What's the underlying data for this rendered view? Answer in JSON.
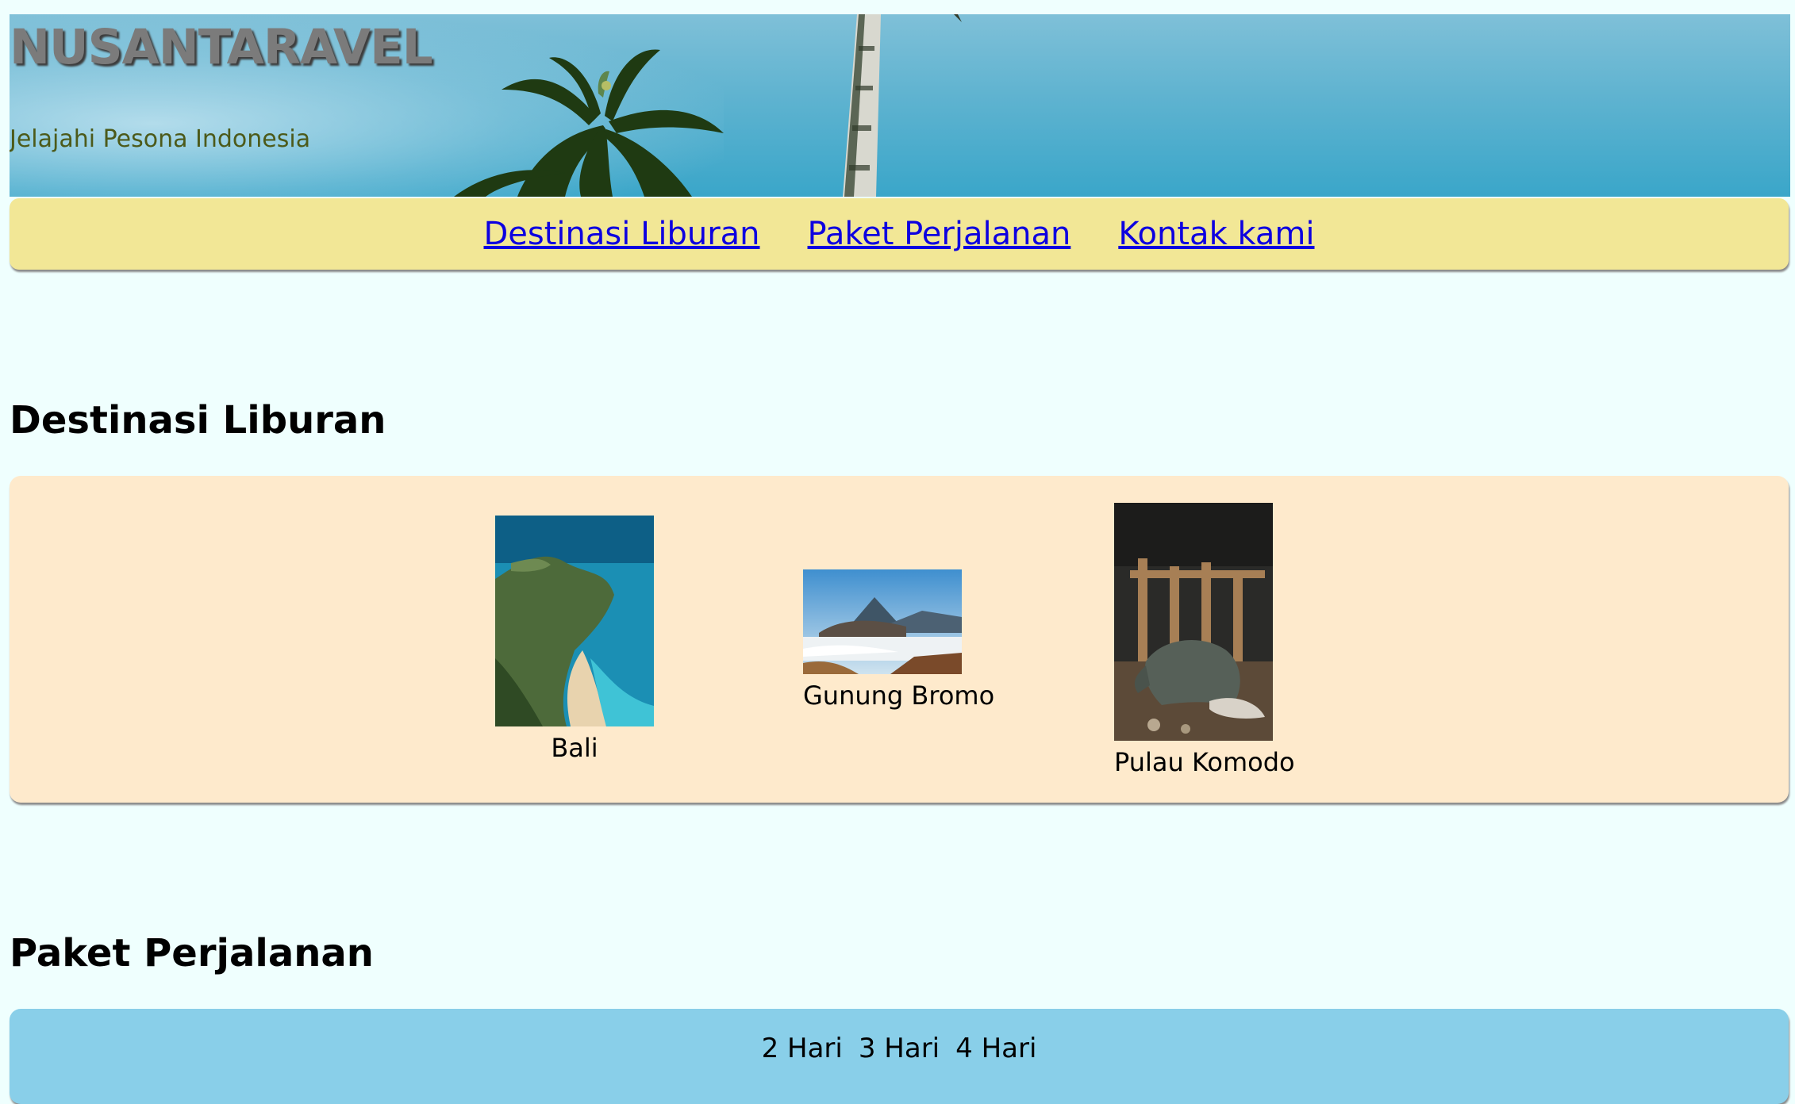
{
  "header": {
    "title": "NUSANTARAVEL",
    "tagline": "Jelajahi Pesona Indonesia"
  },
  "nav": {
    "links": [
      "Destinasi Liburan",
      "Paket Perjalanan",
      "Kontak kami"
    ]
  },
  "destinations": {
    "heading": "Destinasi Liburan",
    "items": [
      {
        "name": "Bali",
        "image": "bali-cliff-beach-photo"
      },
      {
        "name": "Gunung Bromo",
        "image": "bromo-volcano-photo"
      },
      {
        "name": "Pulau Komodo",
        "image": "komodo-dragon-photo"
      }
    ]
  },
  "packages": {
    "heading": "Paket Perjalanan",
    "tabs": [
      "2 Hari",
      "3 Hari",
      "4 Hari"
    ]
  },
  "colors": {
    "page_bg": "#effffe",
    "nav_bg": "#f2e796",
    "link": "#0d00e0",
    "destinations_bg": "#feeacc",
    "packages_bg": "#89cfe9"
  }
}
